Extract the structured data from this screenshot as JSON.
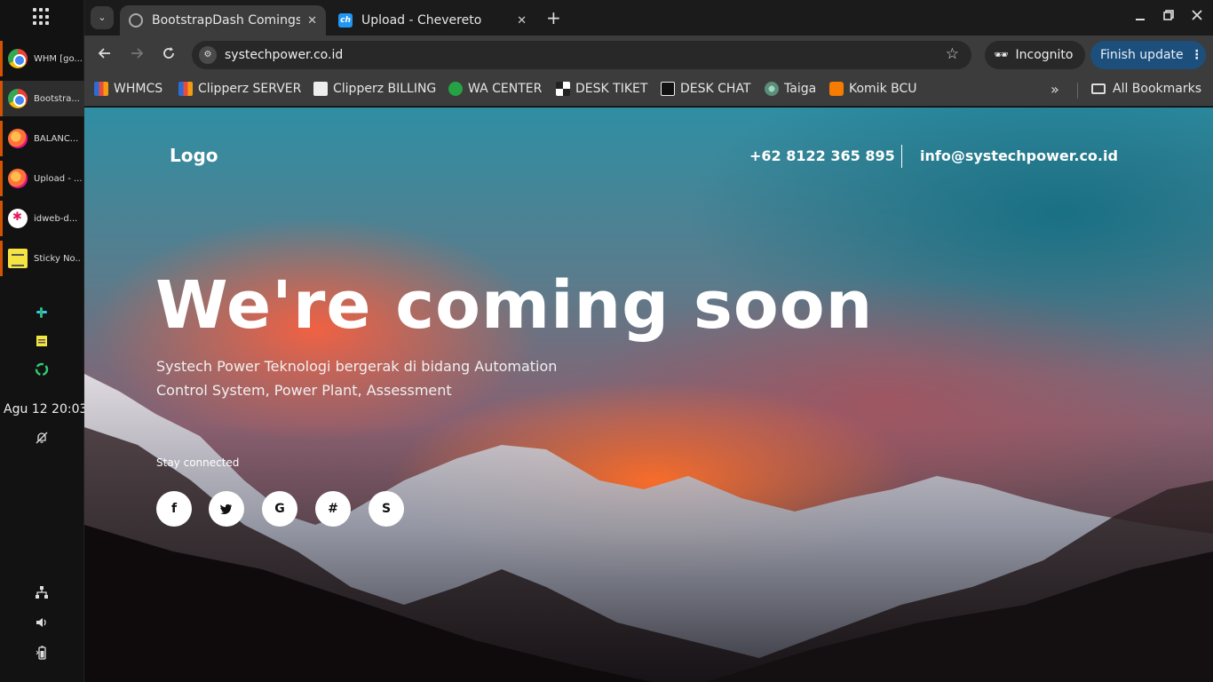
{
  "taskbar": {
    "items": [
      {
        "label": "WHM [go...",
        "app": "chrome"
      },
      {
        "label": "Bootstra...",
        "app": "chrome"
      },
      {
        "label": "BALANC...",
        "app": "firefox"
      },
      {
        "label": "Upload - ...",
        "app": "firefox"
      },
      {
        "label": "idweb-d...",
        "app": "slack"
      },
      {
        "label": "Sticky No...",
        "app": "sticky"
      }
    ],
    "clock": "Agu 12  20:03"
  },
  "browser": {
    "tabs": [
      {
        "title": "BootstrapDash Comingsoon",
        "close": "✕"
      },
      {
        "title": "Upload - Chevereto",
        "favicon_text": "ch",
        "close": "✕"
      }
    ],
    "new_tab": "+",
    "url": "systechpower.co.id",
    "incognito_label": "Incognito",
    "finish_update_label": "Finish update",
    "bookmarks": [
      {
        "label": "WHMCS",
        "icon": "blocks"
      },
      {
        "label": "Clipperz SERVER",
        "icon": "blocks"
      },
      {
        "label": "Clipperz BILLING",
        "icon": "white"
      },
      {
        "label": "WA CENTER",
        "icon": "wa"
      },
      {
        "label": "DESK TIKET",
        "icon": "bw"
      },
      {
        "label": "DESK CHAT",
        "icon": "dark"
      },
      {
        "label": "Taiga",
        "icon": "taiga"
      },
      {
        "label": "Komik BCU",
        "icon": "blogger"
      }
    ],
    "more_bookmarks": "»",
    "all_bookmarks": "All Bookmarks"
  },
  "page": {
    "logo": "Logo",
    "phone": "+62 8122 365 895",
    "email": "info@systechpower.co.id",
    "headline": "We're coming soon",
    "subtitle_line1": "Systech Power Teknologi bergerak di bidang Automation",
    "subtitle_line2": "Control System, Power Plant, Assessment",
    "stay_connected": "Stay connected",
    "social": [
      {
        "name": "facebook-icon",
        "glyph": "f"
      },
      {
        "name": "twitter-icon",
        "glyph": "🐦"
      },
      {
        "name": "google-icon",
        "glyph": "G"
      },
      {
        "name": "slack-icon",
        "glyph": "#"
      },
      {
        "name": "skype-icon",
        "glyph": "S"
      }
    ]
  }
}
